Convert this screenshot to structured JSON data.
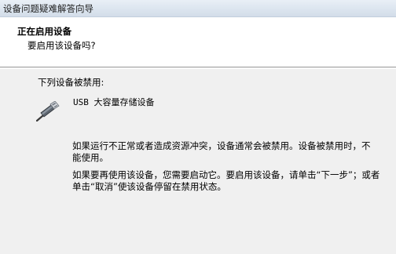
{
  "window": {
    "title": "设备问题疑难解答向导"
  },
  "header": {
    "heading": "正在启用设备",
    "subheading": "要启用该设备吗?"
  },
  "content": {
    "disabled_label": "下列设备被禁用:",
    "device": {
      "name": "USB 大容量存储设备",
      "icon": "usb-connector-icon"
    },
    "paragraph1": "如果运行不正常或者造成资源冲突，设备通常会被禁用。设备被禁用时，不能使用。",
    "paragraph2": "如果要再使用该设备，您需要启动它。要启用该设备，请单击“下一步”；或者单击“取消”使该设备停留在禁用状态。"
  }
}
